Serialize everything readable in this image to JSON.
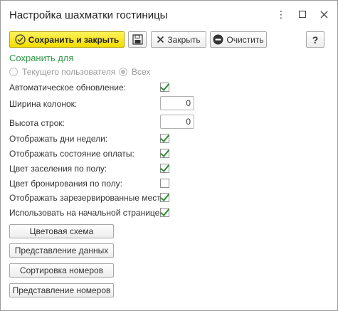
{
  "window": {
    "title": "Настройка шахматки гостиницы"
  },
  "titlebar_icons": {
    "more": "more-icon",
    "maximize": "maximize-icon",
    "close": "close-icon"
  },
  "toolbar": {
    "save_close_label": "Сохранить и закрыть",
    "close_label": "Закрыть",
    "clear_label": "Очистить",
    "help_label": "?"
  },
  "save_for": {
    "label": "Сохранить для",
    "options": [
      "Текущего пользователя",
      "Всех"
    ],
    "selected": "Всех"
  },
  "settings": {
    "auto_update": {
      "label": "Автоматическое обновление:",
      "checked": true
    },
    "column_width": {
      "label": "Ширина колонок:",
      "value": "0"
    },
    "row_height": {
      "label": "Высота строк:",
      "value": "0"
    },
    "show_weekdays": {
      "label": "Отображать дни недели:",
      "checked": true
    },
    "show_payment": {
      "label": "Отображать состояние оплаты:",
      "checked": true
    },
    "color_by_gender": {
      "label": "Цвет заселения по полу:",
      "checked": true
    },
    "booking_color_by_gender": {
      "label": "Цвет бронирования по полу:",
      "checked": false
    },
    "show_reserved": {
      "label": "Отображать зарезервированные места:",
      "checked": true
    },
    "use_on_home": {
      "label": "Использовать на начальной странице:",
      "checked": true
    }
  },
  "actions": {
    "color_scheme": "Цветовая схема",
    "data_view": "Представление данных",
    "room_sort": "Сортировка номеров",
    "room_view": "Представление номеров"
  },
  "colors": {
    "accent_green": "#2e9944",
    "primary_yellow": "#f2dc00",
    "check_green": "#2f8a36"
  }
}
